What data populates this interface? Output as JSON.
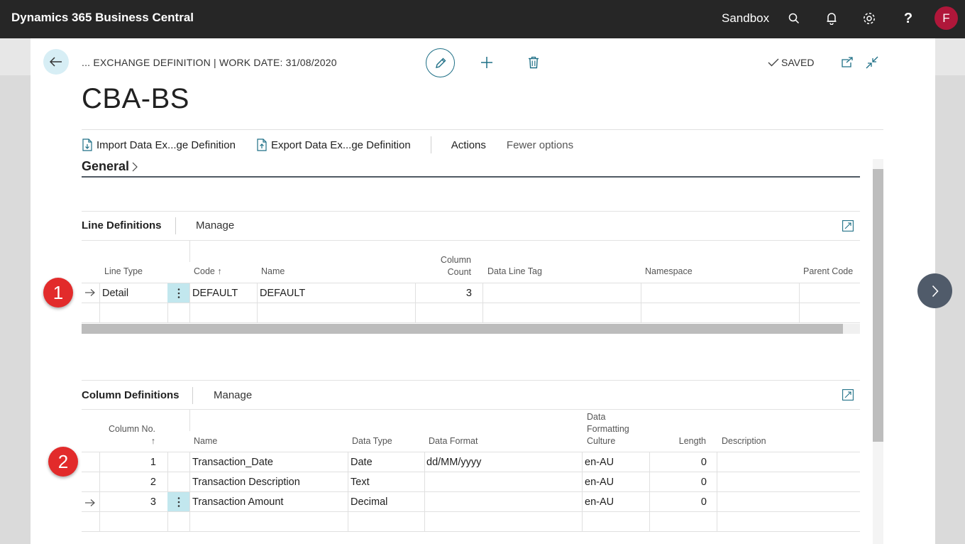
{
  "appbar": {
    "brand": "Dynamics 365 Business Central",
    "environment": "Sandbox",
    "avatar_initial": "F",
    "icons": [
      "search-icon",
      "bell-icon",
      "gear-icon",
      "help-icon"
    ]
  },
  "header": {
    "breadcrumb": "... EXCHANGE DEFINITION | WORK DATE: 31/08/2020",
    "saved_label": "SAVED",
    "title": "CBA-BS"
  },
  "actions": {
    "import_label": "Import Data Ex...ge Definition",
    "export_label": "Export Data Ex...ge Definition",
    "actions_label": "Actions",
    "fewer_label": "Fewer options"
  },
  "general": {
    "label": "General"
  },
  "line_definitions": {
    "title": "Line Definitions",
    "manage_label": "Manage",
    "columns": {
      "line_type": "Line Type",
      "code": "Code ↑",
      "name": "Name",
      "column_count_1": "Column",
      "column_count_2": "Count",
      "data_line_tag": "Data Line Tag",
      "namespace": "Namespace",
      "parent_code": "Parent Code"
    },
    "rows": [
      {
        "line_type": "Detail",
        "code": "DEFAULT",
        "name": "DEFAULT",
        "column_count": "3",
        "data_line_tag": "",
        "namespace": "",
        "parent_code": ""
      }
    ]
  },
  "column_definitions": {
    "title": "Column Definitions",
    "manage_label": "Manage",
    "columns": {
      "column_no_1": "Column No.",
      "column_no_2": "↑",
      "name": "Name",
      "data_type": "Data Type",
      "data_format": "Data Format",
      "culture_1": "Data",
      "culture_2": "Formatting",
      "culture_3": "Culture",
      "length": "Length",
      "description": "Description"
    },
    "rows": [
      {
        "column_no": "1",
        "name": "Transaction_Date",
        "data_type": "Date",
        "data_format": "dd/MM/yyyy",
        "culture": "en-AU",
        "length": "0",
        "description": ""
      },
      {
        "column_no": "2",
        "name": "Transaction Description",
        "data_type": "Text",
        "data_format": "",
        "culture": "en-AU",
        "length": "0",
        "description": ""
      },
      {
        "column_no": "3",
        "name": "Transaction Amount",
        "data_type": "Decimal",
        "data_format": "",
        "culture": "en-AU",
        "length": "0",
        "description": ""
      }
    ]
  },
  "badges": {
    "first": "1",
    "second": "2"
  },
  "colors": {
    "appbar": "#262626",
    "avatar": "#b0173a",
    "accent": "#1e6f86",
    "badge": "#e22b2b",
    "selection": "#c2e7ee"
  }
}
